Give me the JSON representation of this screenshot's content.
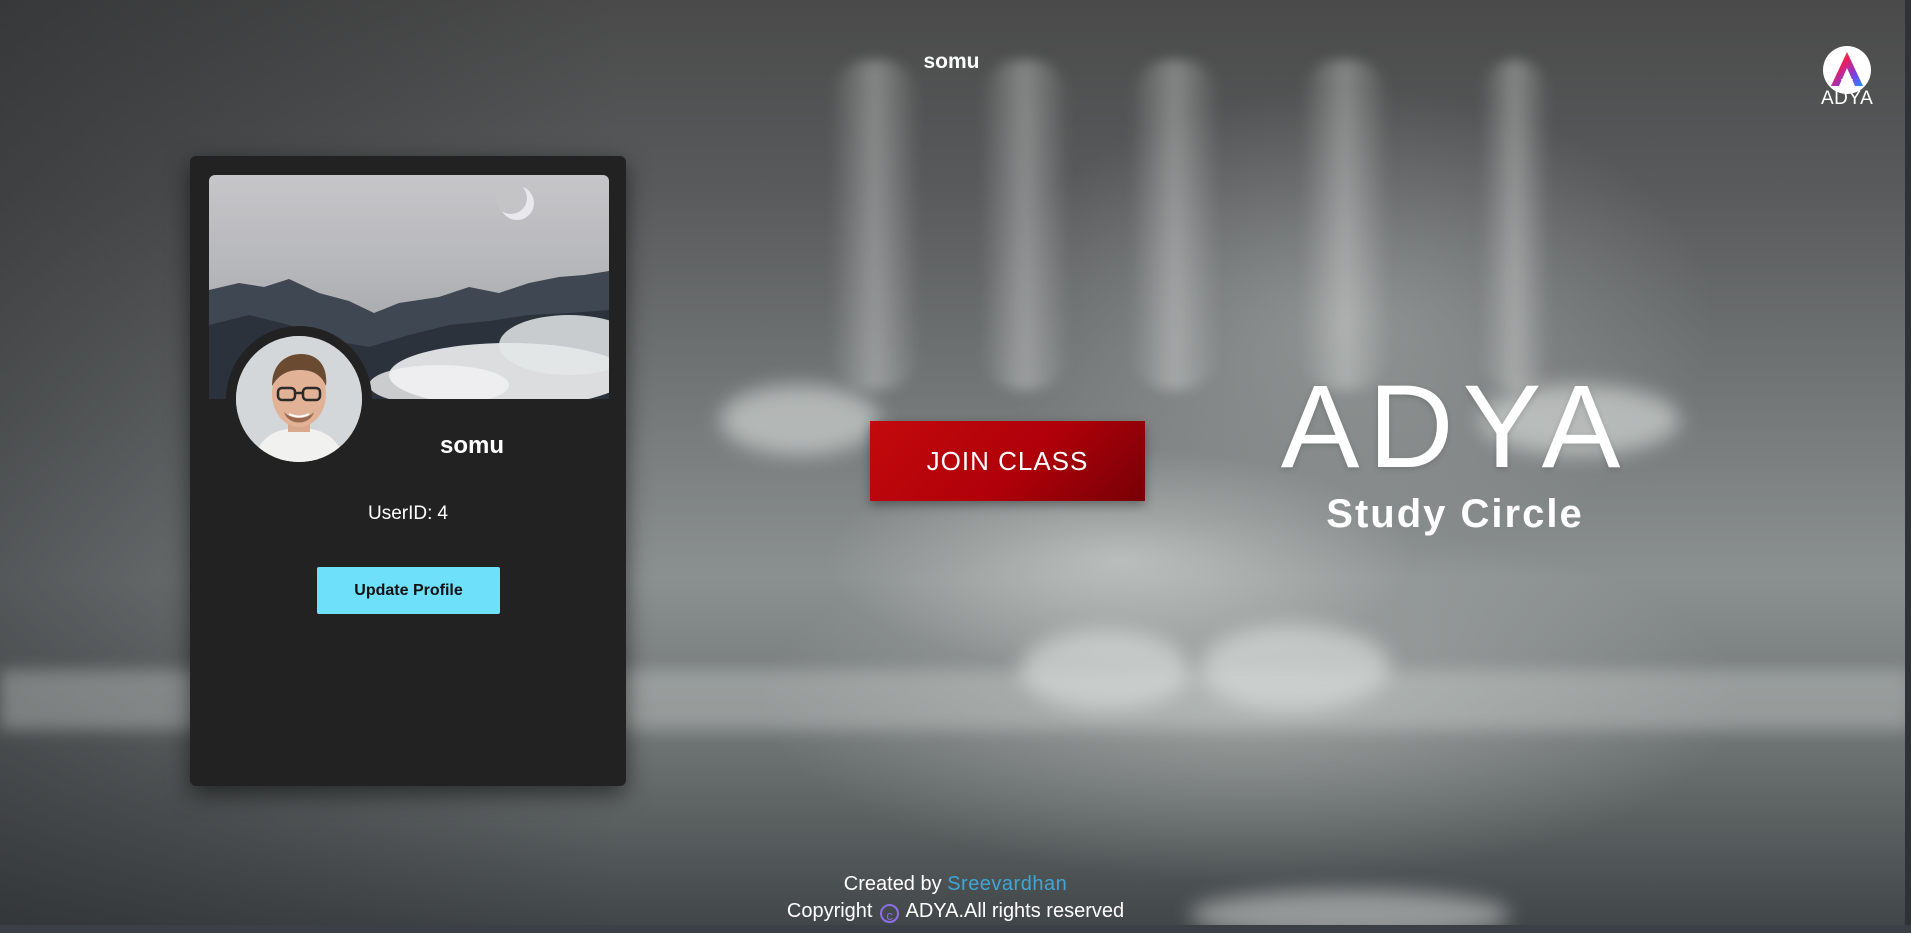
{
  "header": {
    "username": "somu",
    "logo_text": "ADYA"
  },
  "profile_card": {
    "name": "somu",
    "userid_label": "UserID:",
    "userid_value": "4",
    "update_button": "Update Profile"
  },
  "main": {
    "join_button": "JOIN CLASS",
    "brand_title": "ADYA",
    "brand_subtitle": "Study Circle"
  },
  "footer": {
    "created_by": "Created by",
    "author": "Sreevardhan",
    "copyright": "Copyright",
    "copyright_symbol": "c",
    "rights": "ADYA.All rights reserved"
  },
  "colors": {
    "join_button": "#b50009",
    "update_button": "#6ee0fa",
    "author_link": "#3fa6d6",
    "card_bg": "#222222"
  }
}
